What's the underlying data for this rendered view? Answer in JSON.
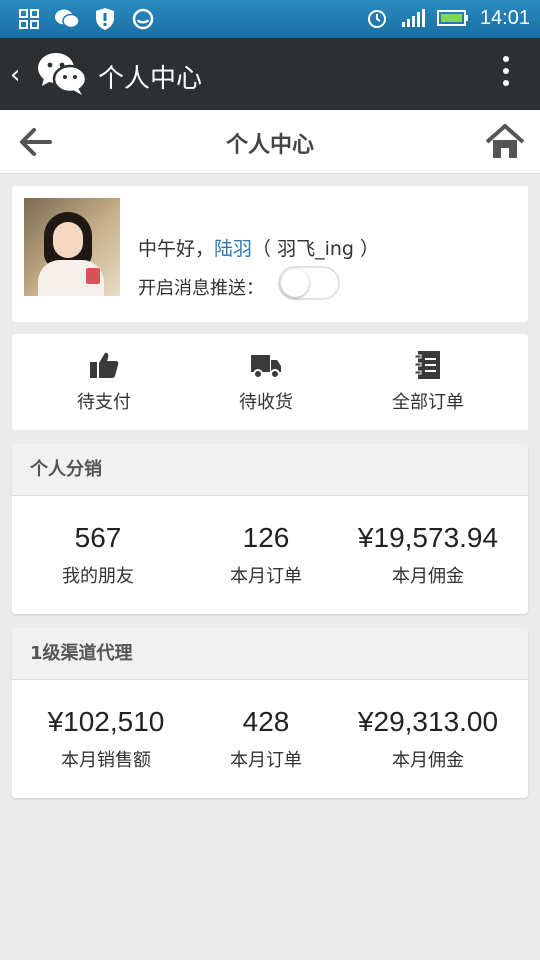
{
  "status_bar": {
    "time": "14:01",
    "left_icons": [
      "apps-grid-icon",
      "wechat-notification-icon",
      "shield-icon",
      "sync-icon"
    ],
    "right_icons": [
      "alarm-icon",
      "signal-icon",
      "battery-icon"
    ]
  },
  "app_bar": {
    "title": "个人中心"
  },
  "page_header": {
    "title": "个人中心"
  },
  "profile": {
    "greeting": "中午好，",
    "name": "陆羽",
    "nickname": "（ 羽飞_ing ）",
    "push_label": "开启消息推送：",
    "push_enabled": false
  },
  "orders": [
    {
      "label": "待支付",
      "icon": "thumbs-up-icon"
    },
    {
      "label": "待收货",
      "icon": "truck-icon"
    },
    {
      "label": "全部订单",
      "icon": "notebook-icon"
    }
  ],
  "distribution": {
    "title": "个人分销",
    "stats": [
      {
        "value": "567",
        "label": "我的朋友"
      },
      {
        "value": "126",
        "label": "本月订单"
      },
      {
        "value": "¥19,573.94",
        "label": "本月佣金"
      }
    ]
  },
  "agent": {
    "title": "1级渠道代理",
    "stats": [
      {
        "value": "¥102,510",
        "label": "本月销售额"
      },
      {
        "value": "428",
        "label": "本月订单"
      },
      {
        "value": "¥29,313.00",
        "label": "本月佣金"
      }
    ]
  },
  "colors": {
    "status_bar": "#1f78ad",
    "app_bar": "#2d3033",
    "page_bg": "#ebebeb",
    "name_link": "#2f79b5"
  }
}
